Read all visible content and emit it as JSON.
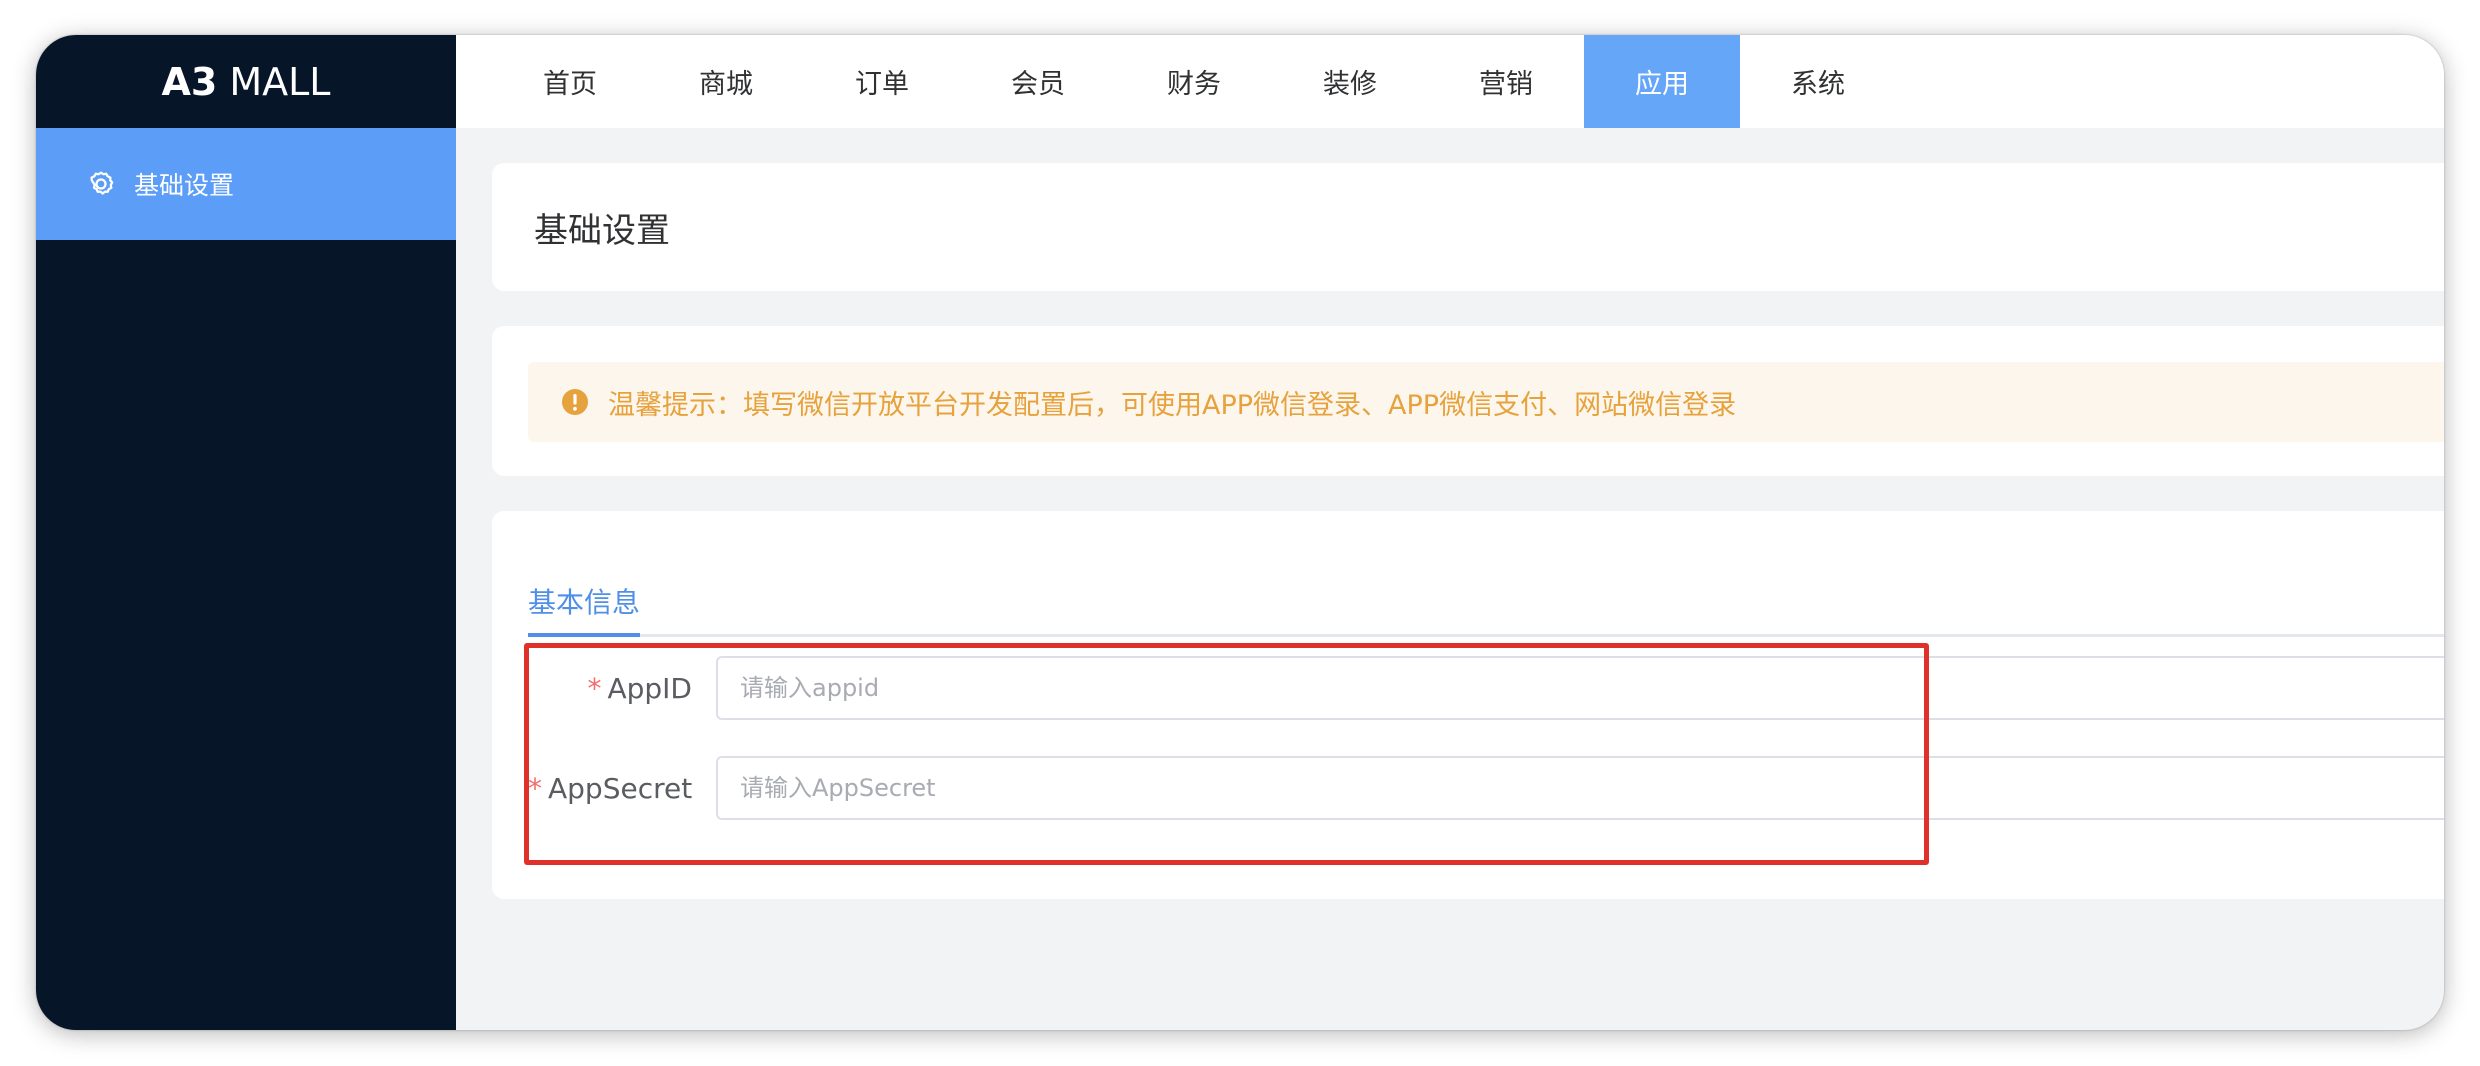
{
  "app": {
    "logo_bold": "A3",
    "logo_text": "MALL"
  },
  "sidebar": {
    "items": [
      {
        "label": "基础设置",
        "icon": "gear-icon"
      }
    ]
  },
  "nav": {
    "items": [
      {
        "label": "首页"
      },
      {
        "label": "商城"
      },
      {
        "label": "订单"
      },
      {
        "label": "会员"
      },
      {
        "label": "财务"
      },
      {
        "label": "装修"
      },
      {
        "label": "营销"
      },
      {
        "label": "应用"
      },
      {
        "label": "系统"
      }
    ],
    "active": "应用"
  },
  "page": {
    "title": "基础设置"
  },
  "alert": {
    "text": "温馨提示：填写微信开放平台开发配置后，可使用APP微信登录、APP微信支付、网站微信登录",
    "icon": "warning-icon"
  },
  "tabs": [
    {
      "label": "基本信息",
      "active": true
    }
  ],
  "form": {
    "required_mark": "*",
    "appid": {
      "label": "AppID",
      "placeholder": "请输入appid",
      "value": ""
    },
    "appsecret": {
      "label": "AppSecret",
      "placeholder": "请输入AppSecret",
      "value": ""
    }
  },
  "colors": {
    "sidebar_bg": "#061628",
    "accent": "#5c9df7",
    "warning": "#e6a23c",
    "required": "#f56c6c",
    "highlight": "#e0302a"
  }
}
